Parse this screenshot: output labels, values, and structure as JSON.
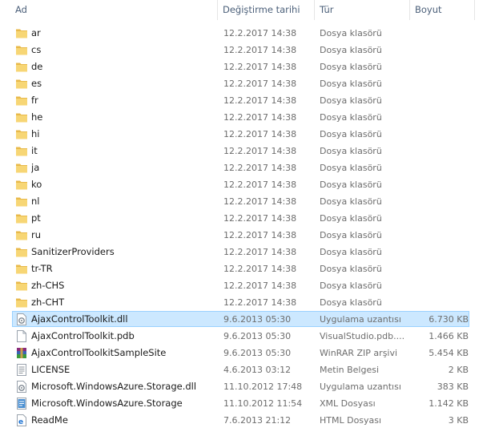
{
  "columns": {
    "name": "Ad",
    "date": "Değiştirme tarihi",
    "type": "Tür",
    "size": "Boyut"
  },
  "sort_indicator": "ˇ",
  "files": [
    {
      "name": "ar",
      "date": "12.2.2017 14:38",
      "type": "Dosya klasörü",
      "size": "",
      "icon": "folder-icon"
    },
    {
      "name": "cs",
      "date": "12.2.2017 14:38",
      "type": "Dosya klasörü",
      "size": "",
      "icon": "folder-icon"
    },
    {
      "name": "de",
      "date": "12.2.2017 14:38",
      "type": "Dosya klasörü",
      "size": "",
      "icon": "folder-icon"
    },
    {
      "name": "es",
      "date": "12.2.2017 14:38",
      "type": "Dosya klasörü",
      "size": "",
      "icon": "folder-icon"
    },
    {
      "name": "fr",
      "date": "12.2.2017 14:38",
      "type": "Dosya klasörü",
      "size": "",
      "icon": "folder-icon"
    },
    {
      "name": "he",
      "date": "12.2.2017 14:38",
      "type": "Dosya klasörü",
      "size": "",
      "icon": "folder-icon"
    },
    {
      "name": "hi",
      "date": "12.2.2017 14:38",
      "type": "Dosya klasörü",
      "size": "",
      "icon": "folder-icon"
    },
    {
      "name": "it",
      "date": "12.2.2017 14:38",
      "type": "Dosya klasörü",
      "size": "",
      "icon": "folder-icon"
    },
    {
      "name": "ja",
      "date": "12.2.2017 14:38",
      "type": "Dosya klasörü",
      "size": "",
      "icon": "folder-icon"
    },
    {
      "name": "ko",
      "date": "12.2.2017 14:38",
      "type": "Dosya klasörü",
      "size": "",
      "icon": "folder-icon"
    },
    {
      "name": "nl",
      "date": "12.2.2017 14:38",
      "type": "Dosya klasörü",
      "size": "",
      "icon": "folder-icon"
    },
    {
      "name": "pt",
      "date": "12.2.2017 14:38",
      "type": "Dosya klasörü",
      "size": "",
      "icon": "folder-icon"
    },
    {
      "name": "ru",
      "date": "12.2.2017 14:38",
      "type": "Dosya klasörü",
      "size": "",
      "icon": "folder-icon"
    },
    {
      "name": "SanitizerProviders",
      "date": "12.2.2017 14:38",
      "type": "Dosya klasörü",
      "size": "",
      "icon": "folder-icon"
    },
    {
      "name": "tr-TR",
      "date": "12.2.2017 14:38",
      "type": "Dosya klasörü",
      "size": "",
      "icon": "folder-icon"
    },
    {
      "name": "zh-CHS",
      "date": "12.2.2017 14:38",
      "type": "Dosya klasörü",
      "size": "",
      "icon": "folder-icon"
    },
    {
      "name": "zh-CHT",
      "date": "12.2.2017 14:38",
      "type": "Dosya klasörü",
      "size": "",
      "icon": "folder-icon"
    },
    {
      "name": "AjaxControlToolkit.dll",
      "date": "9.6.2013 05:30",
      "type": "Uygulama uzantısı",
      "size": "6.730 KB",
      "icon": "dll-icon",
      "selected": true
    },
    {
      "name": "AjaxControlToolkit.pdb",
      "date": "9.6.2013 05:30",
      "type": "VisualStudio.pdb....",
      "size": "1.466 KB",
      "icon": "blank-file-icon"
    },
    {
      "name": "AjaxControlToolkitSampleSite",
      "date": "9.6.2013 05:30",
      "type": "WinRAR ZIP arşivi",
      "size": "5.454 KB",
      "icon": "winrar-icon"
    },
    {
      "name": "LICENSE",
      "date": "4.6.2013 03:12",
      "type": "Metin Belgesi",
      "size": "2 KB",
      "icon": "text-file-icon"
    },
    {
      "name": "Microsoft.WindowsAzure.Storage.dll",
      "date": "11.10.2012 17:48",
      "type": "Uygulama uzantısı",
      "size": "383 KB",
      "icon": "dll-icon"
    },
    {
      "name": "Microsoft.WindowsAzure.Storage",
      "date": "11.10.2012 11:54",
      "type": "XML Dosyası",
      "size": "1.142 KB",
      "icon": "xml-file-icon"
    },
    {
      "name": "ReadMe",
      "date": "7.6.2013 21:12",
      "type": "HTML Dosyası",
      "size": "3 KB",
      "icon": "html-file-icon"
    }
  ],
  "colors": {
    "header_text": "#4c607a",
    "secondary_text": "#6d6d6d",
    "selection_bg": "#cce8ff",
    "selection_border": "#99d1ff",
    "folder": "#f7d675"
  }
}
